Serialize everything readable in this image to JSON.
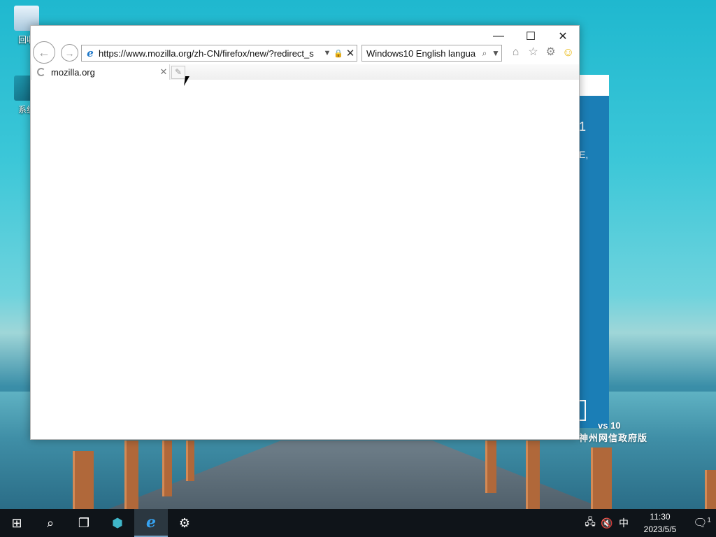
{
  "desktop": {
    "icons": [
      {
        "label": "回收"
      },
      {
        "label": "系统"
      }
    ],
    "watermark_line1": "vs 10",
    "watermark_line2": "神州网信政府版",
    "bg_window_text1": "1",
    "bg_window_text2": "E,"
  },
  "browser": {
    "url": "https://www.mozilla.org/zh-CN/firefox/new/?redirect_s",
    "search_text": "Windows10 English langua",
    "tab_title": "mozilla.org",
    "caption": {
      "minimize": "—",
      "maximize": "☐",
      "close": "✕"
    }
  },
  "icons": {
    "back": "arrow-left-icon",
    "forward": "arrow-right-icon",
    "home": "home-icon",
    "favorites": "star-icon",
    "tools": "gear-icon",
    "feedback": "smiley-icon"
  },
  "taskbar": {
    "time": "11:30",
    "date": "2023/5/5",
    "ime": "中",
    "notification_count": "1"
  }
}
